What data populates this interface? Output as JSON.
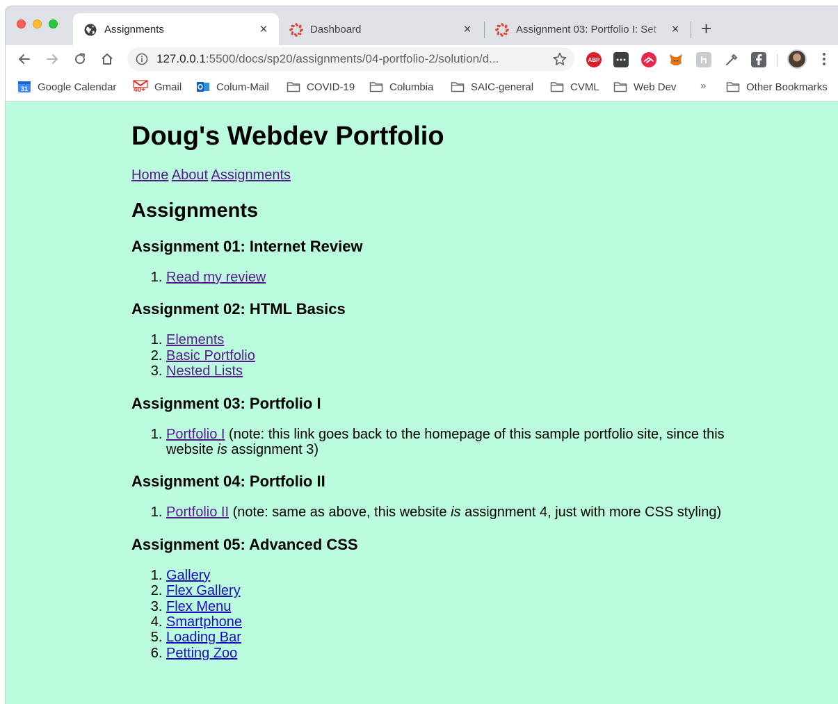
{
  "browser": {
    "tabs": [
      {
        "title": "Assignments",
        "icon": "globe-icon",
        "active": true
      },
      {
        "title": "Dashboard",
        "icon": "canvas-icon",
        "active": false
      },
      {
        "title": "Assignment 03: Portfolio I: Set",
        "icon": "canvas-icon",
        "active": false
      }
    ],
    "close_glyph": "×",
    "newtab_glyph": "+",
    "url": {
      "host": "127.0.0.1",
      "rest": ":5500/docs/sp20/assignments/04-portfolio-2/solution/d..."
    },
    "bookmarks": [
      {
        "label": "Google Calendar",
        "icon": "google-calendar-icon"
      },
      {
        "label": "Gmail",
        "icon": "gmail-icon",
        "badge": "40+"
      },
      {
        "label": "Colum-Mail",
        "icon": "outlook-icon"
      },
      {
        "label": "COVID-19",
        "icon": "folder-icon"
      },
      {
        "label": "Columbia",
        "icon": "folder-icon"
      },
      {
        "label": "SAIC-general",
        "icon": "folder-icon"
      },
      {
        "label": "CVML",
        "icon": "folder-icon"
      },
      {
        "label": "Web Dev",
        "icon": "folder-icon"
      }
    ],
    "bookmarks_more": "»",
    "other_bookmarks": "Other Bookmarks",
    "calendar_icon_text": "31",
    "abp_text": "ABP",
    "colors": {
      "tabstrip": "#dee1e6",
      "page_bg": "#bbfcdf",
      "link": "#1b0cc1",
      "visited_link": "#551a8b"
    }
  },
  "page": {
    "title": "Doug's Webdev Portfolio",
    "nav": [
      "Home",
      "About",
      "Assignments"
    ],
    "heading": "Assignments",
    "sections": [
      {
        "title": "Assignment 01: Internet Review",
        "items": [
          {
            "link": "Read my review",
            "visited": true
          }
        ]
      },
      {
        "title": "Assignment 02: HTML Basics",
        "items": [
          {
            "link": "Elements",
            "visited": true
          },
          {
            "link": "Basic Portfolio",
            "visited": true
          },
          {
            "link": "Nested Lists",
            "visited": true
          }
        ]
      },
      {
        "title": "Assignment 03: Portfolio I",
        "items": [
          {
            "link": "Portfolio I",
            "visited": true,
            "note_before": " (note: this link goes back to the homepage of this sample portfolio site, since this website ",
            "note_em": "is",
            "note_after": " assignment 3)"
          }
        ]
      },
      {
        "title": "Assignment 04: Portfolio II",
        "items": [
          {
            "link": "Portfolio II",
            "visited": true,
            "note_before": " (note: same as above, this website ",
            "note_em": "is",
            "note_after": " assignment 4, just with more CSS styling)"
          }
        ]
      },
      {
        "title": "Assignment 05: Advanced CSS",
        "items": [
          {
            "link": "Gallery",
            "visited": false
          },
          {
            "link": "Flex Gallery",
            "visited": false
          },
          {
            "link": "Flex Menu",
            "visited": false
          },
          {
            "link": "Smartphone",
            "visited": false
          },
          {
            "link": "Loading Bar",
            "visited": false
          },
          {
            "link": "Petting Zoo",
            "visited": false
          }
        ]
      }
    ]
  }
}
